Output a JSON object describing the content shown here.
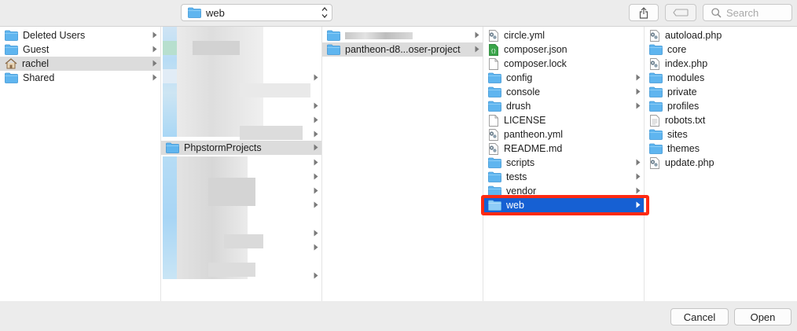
{
  "toolbar": {
    "path_popup_label": "web",
    "search_placeholder": "Search"
  },
  "columns": {
    "col1": [
      {
        "label": "Deleted Users",
        "icon": "folder-icon",
        "has_children": true
      },
      {
        "label": "Guest",
        "icon": "folder-icon",
        "has_children": true
      },
      {
        "label": "rachel",
        "icon": "home-icon",
        "has_children": true,
        "selected": true
      },
      {
        "label": "Shared",
        "icon": "folder-icon",
        "has_children": true
      }
    ],
    "col2_selected": {
      "label": "PhpstormProjects",
      "icon": "folder-icon",
      "has_children": true
    },
    "col3": [
      {
        "label": "",
        "icon": "folder-icon",
        "has_children": true,
        "redacted": true
      },
      {
        "label": "pantheon-d8...oser-project",
        "icon": "folder-icon",
        "has_children": true,
        "selected": true
      }
    ],
    "col4": [
      {
        "label": "circle.yml",
        "icon": "script-file-icon"
      },
      {
        "label": "composer.json",
        "icon": "json-file-icon"
      },
      {
        "label": "composer.lock",
        "icon": "document-icon"
      },
      {
        "label": "config",
        "icon": "folder-icon",
        "has_children": true
      },
      {
        "label": "console",
        "icon": "folder-icon",
        "has_children": true
      },
      {
        "label": "drush",
        "icon": "folder-icon",
        "has_children": true
      },
      {
        "label": "LICENSE",
        "icon": "document-icon"
      },
      {
        "label": "pantheon.yml",
        "icon": "script-file-icon"
      },
      {
        "label": "README.md",
        "icon": "script-file-icon"
      },
      {
        "label": "scripts",
        "icon": "folder-icon",
        "has_children": true
      },
      {
        "label": "tests",
        "icon": "folder-icon",
        "has_children": true
      },
      {
        "label": "vendor",
        "icon": "folder-icon",
        "has_children": true
      },
      {
        "label": "web",
        "icon": "folder-icon",
        "has_children": true,
        "selected": true
      }
    ],
    "col5": [
      {
        "label": "autoload.php",
        "icon": "script-file-icon"
      },
      {
        "label": "core",
        "icon": "folder-icon"
      },
      {
        "label": "index.php",
        "icon": "script-file-icon"
      },
      {
        "label": "modules",
        "icon": "folder-icon"
      },
      {
        "label": "private",
        "icon": "folder-icon"
      },
      {
        "label": "profiles",
        "icon": "folder-icon"
      },
      {
        "label": "robots.txt",
        "icon": "text-file-icon"
      },
      {
        "label": "sites",
        "icon": "folder-icon"
      },
      {
        "label": "themes",
        "icon": "folder-icon"
      },
      {
        "label": "update.php",
        "icon": "script-file-icon"
      }
    ]
  },
  "buttons": {
    "cancel": "Cancel",
    "open": "Open"
  },
  "colors": {
    "selection_blue": "#1660d3",
    "selection_grey": "#dcdcdc",
    "folder_blue": "#5fb5ef",
    "highlight_red": "#ff2a13"
  }
}
